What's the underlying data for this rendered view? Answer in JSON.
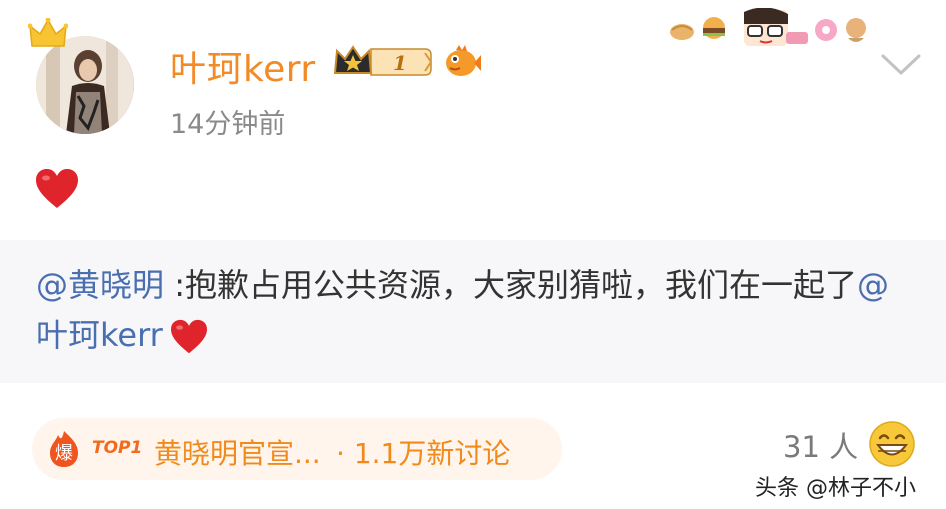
{
  "user": {
    "name": "叶珂kerr",
    "timestamp": "14分钟前",
    "vip_level": "1"
  },
  "quote": {
    "mention": "@黄晓明",
    "text": " :抱歉占用公共资源，大家别猜啦，我们在一起了",
    "tag_mention": "@叶珂kerr"
  },
  "topic": {
    "badge": "爆",
    "rank": "TOP1",
    "title": "黄晓明官宣...",
    "separator": "·",
    "stats": "1.1万新讨论"
  },
  "reactions": {
    "likers": "31 人"
  },
  "watermark": "头条 @林子不小",
  "colors": {
    "username": "#f28a27",
    "mention": "#4a6fb0",
    "topic_text": "#f08a1a",
    "quote_bg": "#f7f7f9",
    "heart": "#e0242b"
  },
  "icons": [
    "crown-icon",
    "vip-badge-icon",
    "fish-icon",
    "chevron-down-icon",
    "heart-icon",
    "fire-icon",
    "grin-emoji-icon",
    "decoration-sticker"
  ]
}
